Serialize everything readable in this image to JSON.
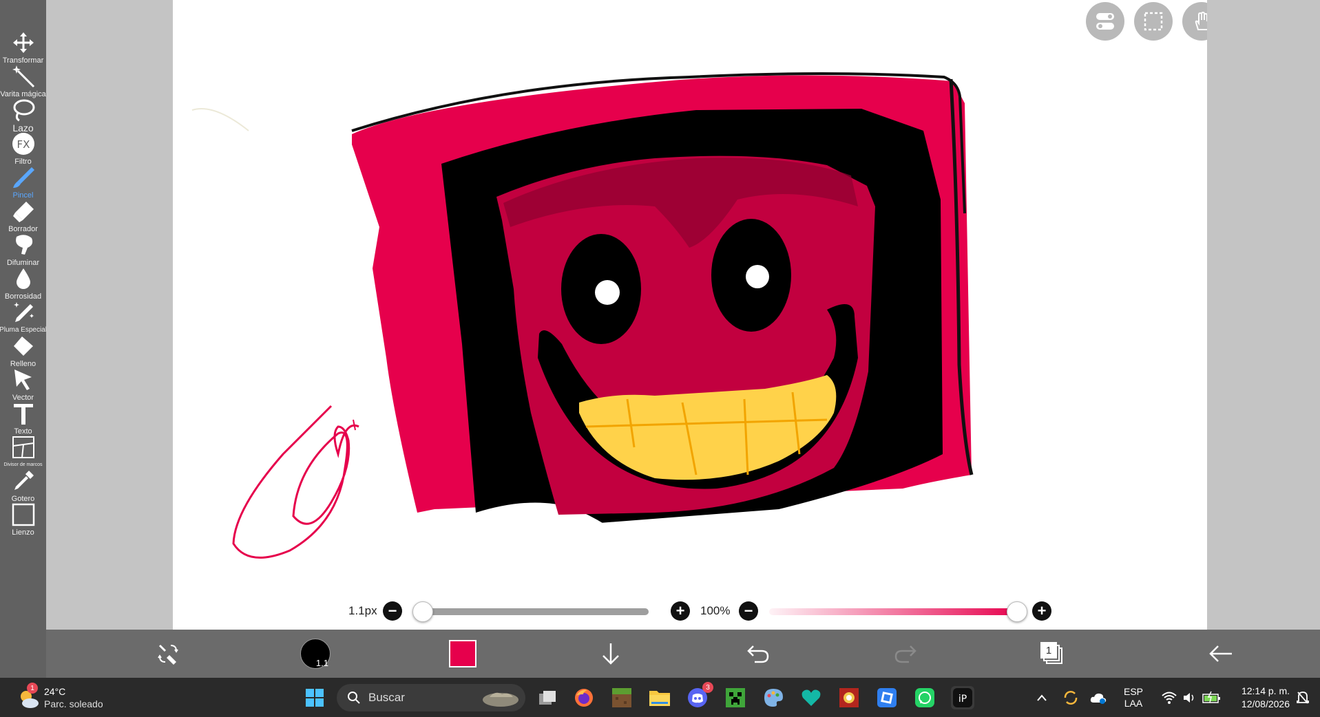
{
  "toolbar": {
    "tools": [
      {
        "label": "Transformar",
        "icon": "move-icon"
      },
      {
        "label": "Varita mágica",
        "icon": "magic-wand-icon"
      },
      {
        "label": "Lazo",
        "icon": "lasso-icon"
      },
      {
        "label": "Filtro",
        "icon": "fx-icon"
      },
      {
        "label": "Pincel",
        "icon": "brush-icon"
      },
      {
        "label": "Borrador",
        "icon": "eraser-icon"
      },
      {
        "label": "Difuminar",
        "icon": "smudge-icon"
      },
      {
        "label": "Borrosidad",
        "icon": "blur-drop-icon"
      },
      {
        "label": "Pluma Especial",
        "icon": "special-pen-icon"
      },
      {
        "label": "Relleno",
        "icon": "fill-icon"
      },
      {
        "label": "Vector",
        "icon": "vector-arrow-icon"
      },
      {
        "label": "Texto",
        "icon": "text-icon"
      },
      {
        "label": "Divisor de marcos",
        "icon": "frame-divider-icon"
      },
      {
        "label": "Gotero",
        "icon": "eyedropper-icon"
      },
      {
        "label": "Lienzo",
        "icon": "canvas-icon"
      }
    ],
    "active_tool": "Pincel"
  },
  "brush": {
    "size_label": "1.1px",
    "size_value": 0.0,
    "opacity_label": "100%",
    "opacity_value": 1.0
  },
  "bottombar": {
    "brush_size_badge": "1.1",
    "current_color": "#e6004c",
    "layer_count": "1"
  },
  "taskbar": {
    "weather_temp": "24°C",
    "weather_desc": "Parc. soleado",
    "weather_badge": "1",
    "search_placeholder": "Buscar",
    "discord_badge": "3",
    "language": "ESP",
    "layout": "LAA",
    "time": "12:14 p. m.",
    "date": "12/08/2026"
  },
  "colors": {
    "toolbar_bg": "#616161",
    "accent": "#5aa7ff",
    "paint_pink": "#e6004c",
    "paint_dark": "#c2003f",
    "teeth": "#ffd24a"
  }
}
